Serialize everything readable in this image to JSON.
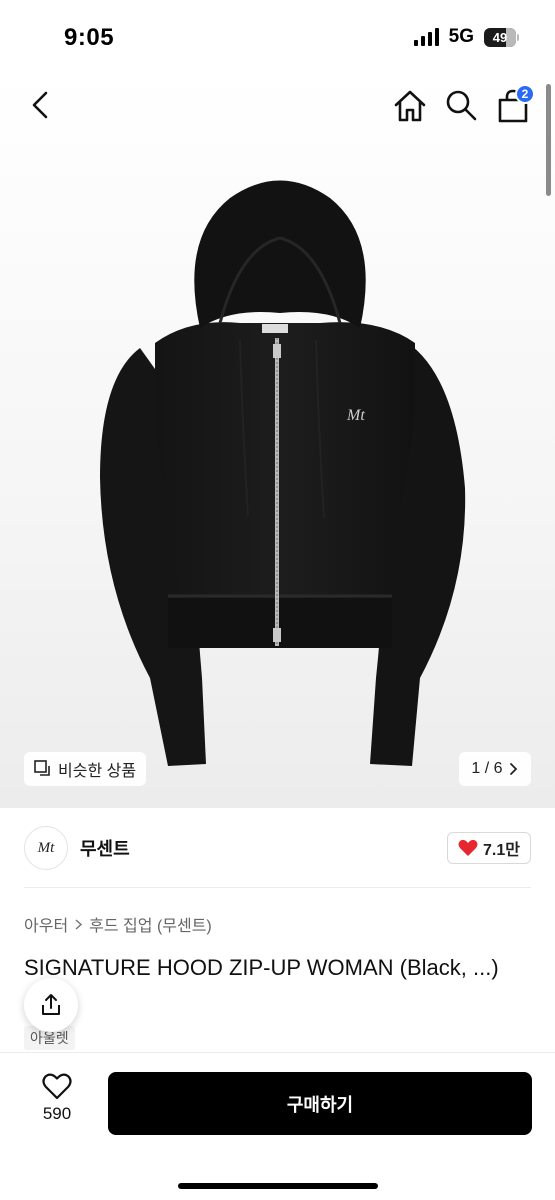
{
  "status_bar": {
    "time": "9:05",
    "network": "5G",
    "battery": "49"
  },
  "nav": {
    "back_icon": "chevron-left-icon",
    "home_icon": "home-icon",
    "search_icon": "search-icon",
    "cart_icon": "shopping-bag-icon",
    "cart_badge": "2",
    "accent_color": "#2b6bf3"
  },
  "gallery": {
    "similar_label": "비슷한 상품",
    "page_indicator": "1 / 6",
    "page_current": 1,
    "page_total": 6
  },
  "brand": {
    "logo_text": "Mt",
    "name": "무센트",
    "likes": "7.1만"
  },
  "breadcrumb": [
    "아우터",
    "후드 집업 (무센트)"
  ],
  "product": {
    "title": "SIGNATURE HOOD ZIP-UP WOMAN (Black, ...)"
  },
  "outlet_label": "아울렛",
  "bottom_bar": {
    "wish_count": "590",
    "buy_label": "구매하기"
  },
  "colors": {
    "heart": "#e8262f",
    "buy_button": "#000000"
  }
}
